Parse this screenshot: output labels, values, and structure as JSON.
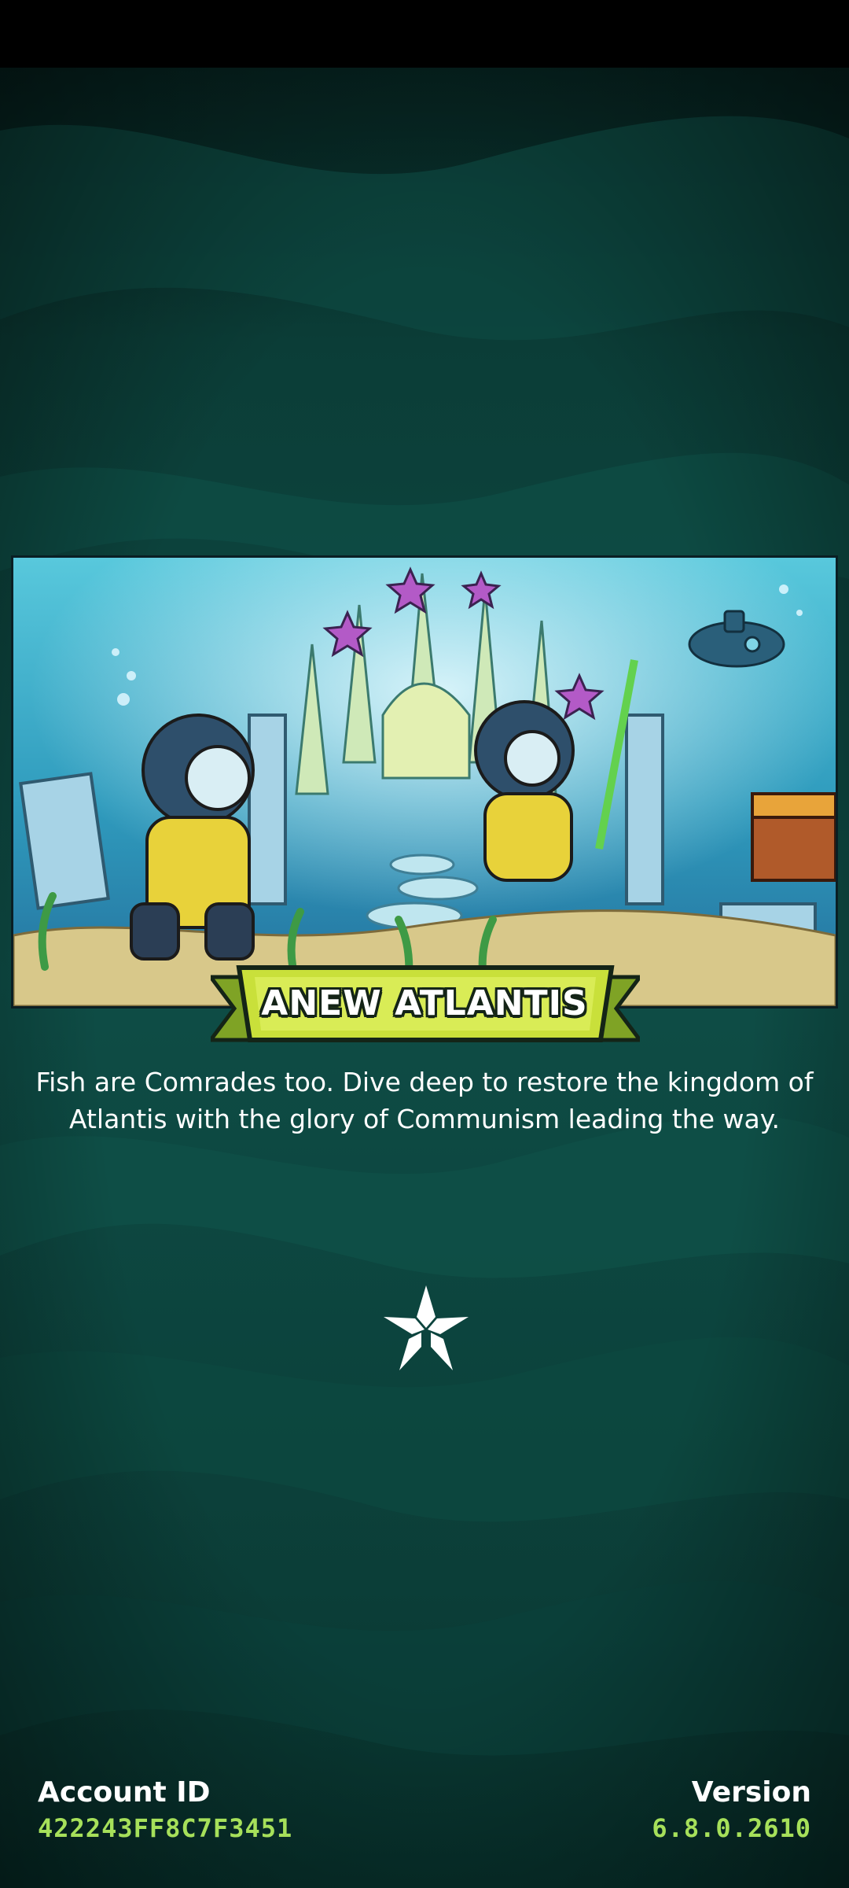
{
  "event": {
    "title": "ANEW ATLANTIS",
    "description": "Fish are Comrades too. Dive deep to restore the kingdom of Atlantis with the glory of Communism leading the way."
  },
  "footer": {
    "account_label": "Account ID",
    "account_value": "422243FF8C7F3451",
    "version_label": "Version",
    "version_value": "6.8.0.2610"
  },
  "icons": {
    "loading": "star-icon"
  },
  "colors": {
    "background": "#0b3b36",
    "ribbon": "#c9e03a",
    "value_text": "#a6e05a",
    "text": "#ffffff"
  }
}
